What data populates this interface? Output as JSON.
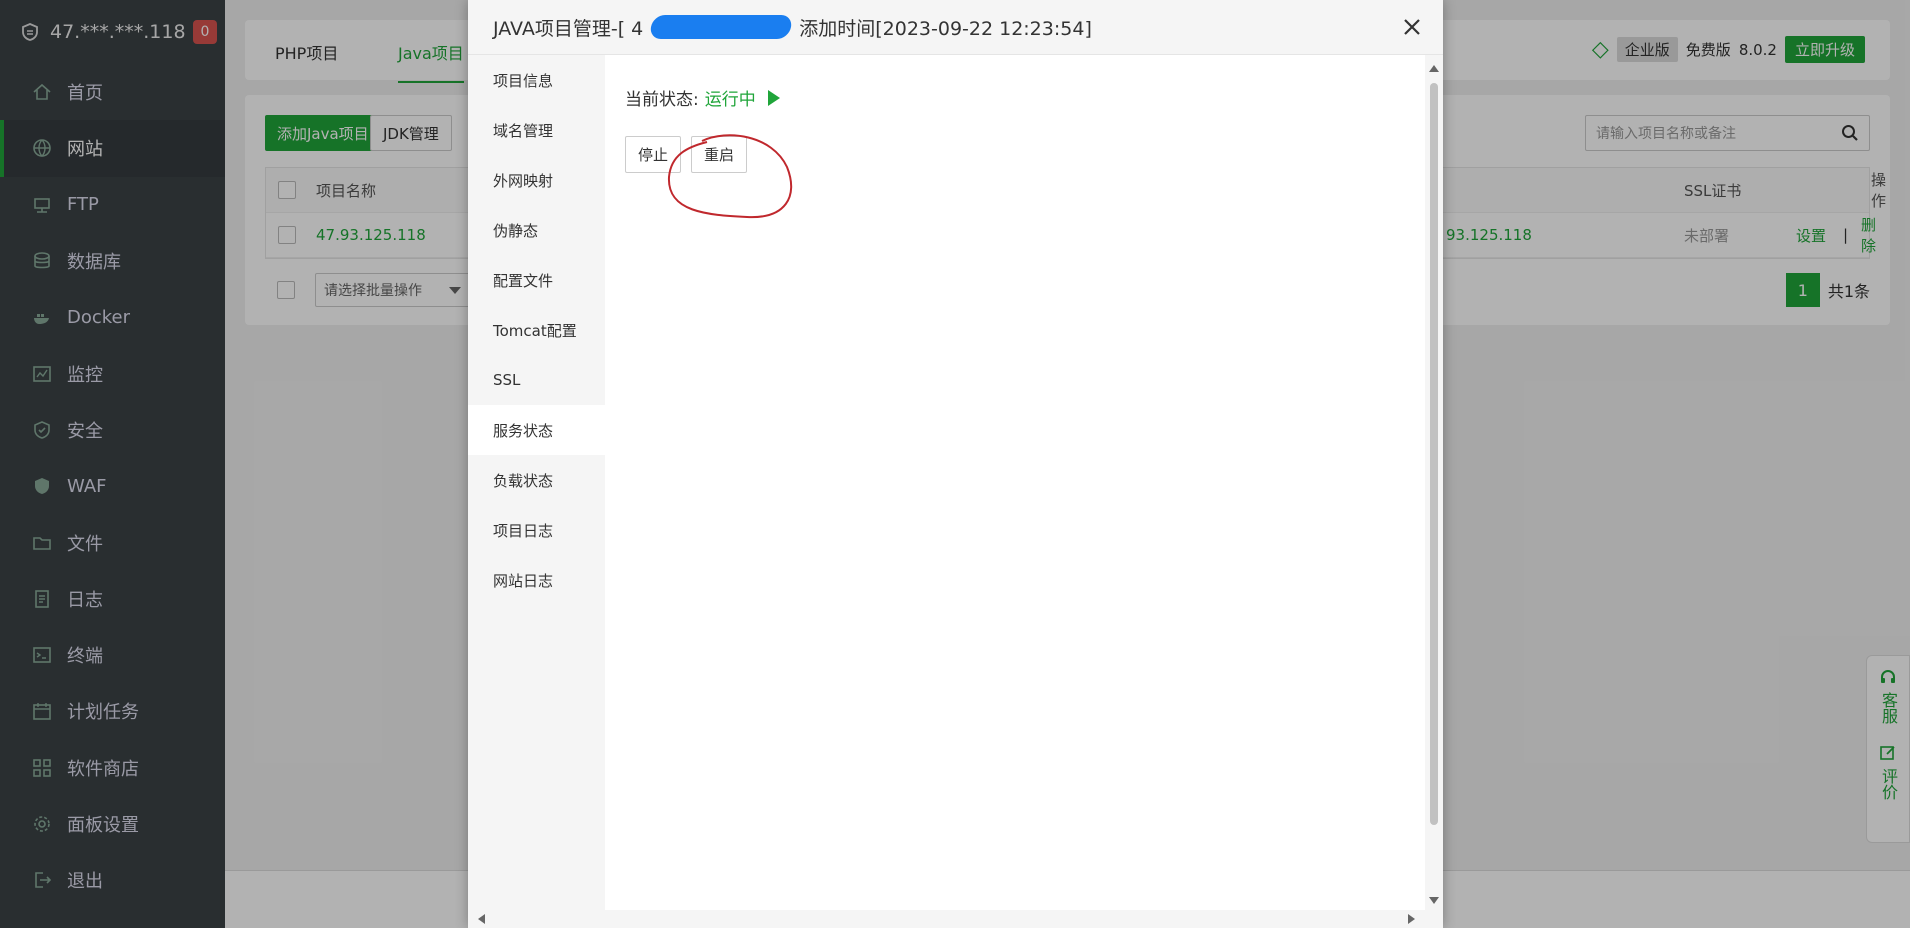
{
  "sidebar": {
    "server_ip": "47.***.***.118",
    "badge_count": "0",
    "items": [
      {
        "label": "首页",
        "icon": "home-icon"
      },
      {
        "label": "网站",
        "icon": "globe-icon"
      },
      {
        "label": "FTP",
        "icon": "ftp-icon"
      },
      {
        "label": "数据库",
        "icon": "database-icon"
      },
      {
        "label": "Docker",
        "icon": "docker-icon"
      },
      {
        "label": "监控",
        "icon": "monitor-icon"
      },
      {
        "label": "安全",
        "icon": "shield-check-icon"
      },
      {
        "label": "WAF",
        "icon": "waf-shield-icon"
      },
      {
        "label": "文件",
        "icon": "folder-icon"
      },
      {
        "label": "日志",
        "icon": "log-icon"
      },
      {
        "label": "终端",
        "icon": "terminal-icon"
      },
      {
        "label": "计划任务",
        "icon": "calendar-icon"
      },
      {
        "label": "软件商店",
        "icon": "apps-icon"
      },
      {
        "label": "面板设置",
        "icon": "gear-icon"
      },
      {
        "label": "退出",
        "icon": "logout-icon"
      }
    ]
  },
  "header": {
    "tabs": [
      "PHP项目",
      "Java项目"
    ],
    "enterprise": "企业版",
    "free": "免费版",
    "version": "8.0.2",
    "upgrade": "立即升级"
  },
  "content": {
    "add_button": "添加Java项目",
    "jdk_button": "JDK管理",
    "search_placeholder": "请输入项目名称或备注",
    "columns": {
      "name": "项目名称",
      "ssl": "SSL证书",
      "ops": "操作"
    },
    "row": {
      "name": "47.93.125.118",
      "domain": "93.125.118",
      "ssl": "未部署",
      "settings": "设置",
      "sep": "|",
      "delete": "删除"
    },
    "batch_placeholder": "请选择批量操作",
    "page": "1",
    "total": "共1条"
  },
  "helpbar": {
    "service": "客服",
    "review": "评价"
  },
  "modal": {
    "title_prefix": "JAVA项目管理-[ 4",
    "title_suffix": "添加时间[2023-09-22 12:23:54]",
    "nav": [
      "项目信息",
      "域名管理",
      "外网映射",
      "伪静态",
      "配置文件",
      "Tomcat配置",
      "SSL",
      "服务状态",
      "负载状态",
      "项目日志",
      "网站日志"
    ],
    "active_nav": 7,
    "status_label": "当前状态:",
    "status_value": "运行中",
    "stop_button": "停止",
    "restart_button": "重启"
  },
  "colors": {
    "accent": "#20a53a",
    "sidebar_bg": "#3b4246",
    "badge": "#d9534f",
    "annotation": "#c0282d"
  }
}
